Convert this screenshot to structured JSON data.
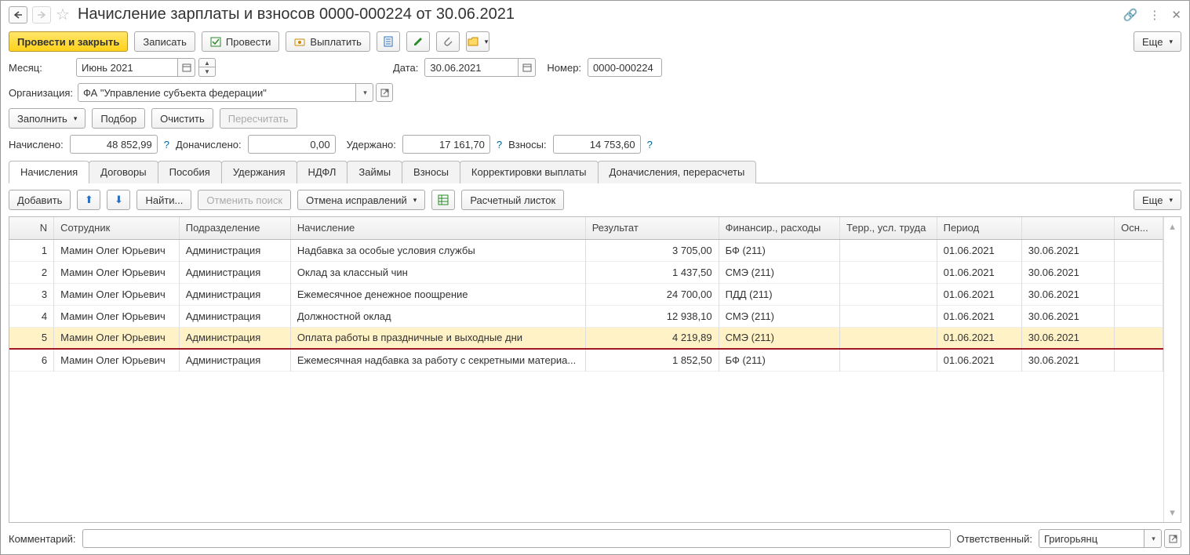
{
  "title": "Начисление зарплаты и взносов 0000-000224 от 30.06.2021",
  "toolbar": {
    "post_close": "Провести и закрыть",
    "save": "Записать",
    "post": "Провести",
    "pay": "Выплатить",
    "more": "Еще"
  },
  "fields": {
    "month_label": "Месяц:",
    "month_value": "Июнь 2021",
    "date_label": "Дата:",
    "date_value": "30.06.2021",
    "number_label": "Номер:",
    "number_value": "0000-000224",
    "org_label": "Организация:",
    "org_value": "ФА \"Управление субъекта федерации\""
  },
  "actions": {
    "fill": "Заполнить",
    "pick": "Подбор",
    "clear": "Очистить",
    "recalc": "Пересчитать"
  },
  "summary": {
    "accrued_label": "Начислено:",
    "accrued_value": "48 852,99",
    "added_label": "Доначислено:",
    "added_value": "0,00",
    "withheld_label": "Удержано:",
    "withheld_value": "17 161,70",
    "contrib_label": "Взносы:",
    "contrib_value": "14 753,60"
  },
  "tabs": [
    "Начисления",
    "Договоры",
    "Пособия",
    "Удержания",
    "НДФЛ",
    "Займы",
    "Взносы",
    "Корректировки выплаты",
    "Доначисления, перерасчеты"
  ],
  "gridbar": {
    "add": "Добавить",
    "find": "Найти...",
    "cancel_find": "Отменить поиск",
    "cancel_fix": "Отмена исправлений",
    "payslip": "Расчетный листок",
    "more": "Еще"
  },
  "columns": {
    "n": "N",
    "employee": "Сотрудник",
    "dept": "Подразделение",
    "accrual": "Начисление",
    "result": "Результат",
    "fin": "Финансир., расходы",
    "terr": "Терр., усл. труда",
    "period": "Период",
    "osn": "Осн..."
  },
  "rows": [
    {
      "n": "1",
      "emp": "Мамин Олег Юрьевич",
      "dept": "Администрация",
      "accr": "Надбавка за особые условия службы",
      "res": "3 705,00",
      "fin": "БФ (211)",
      "p1": "01.06.2021",
      "p2": "30.06.2021"
    },
    {
      "n": "2",
      "emp": "Мамин Олег Юрьевич",
      "dept": "Администрация",
      "accr": "Оклад за классный чин",
      "res": "1 437,50",
      "fin": "СМЭ (211)",
      "p1": "01.06.2021",
      "p2": "30.06.2021"
    },
    {
      "n": "3",
      "emp": "Мамин Олег Юрьевич",
      "dept": "Администрация",
      "accr": "Ежемесячное денежное поощрение",
      "res": "24 700,00",
      "fin": "ПДД (211)",
      "p1": "01.06.2021",
      "p2": "30.06.2021"
    },
    {
      "n": "4",
      "emp": "Мамин Олег Юрьевич",
      "dept": "Администрация",
      "accr": "Должностной оклад",
      "res": "12 938,10",
      "fin": "СМЭ (211)",
      "p1": "01.06.2021",
      "p2": "30.06.2021"
    },
    {
      "n": "5",
      "emp": "Мамин Олег Юрьевич",
      "dept": "Администрация",
      "accr": "Оплата работы в праздничные и выходные дни",
      "res": "4 219,89",
      "fin": "СМЭ (211)",
      "p1": "01.06.2021",
      "p2": "30.06.2021",
      "sel": true
    },
    {
      "n": "6",
      "emp": "Мамин Олег Юрьевич",
      "dept": "Администрация",
      "accr": "Ежемесячная надбавка за работу с секретными материа...",
      "res": "1 852,50",
      "fin": "БФ (211)",
      "p1": "01.06.2021",
      "p2": "30.06.2021"
    }
  ],
  "footer": {
    "comment_label": "Комментарий:",
    "responsible_label": "Ответственный:",
    "responsible_value": "Григорьянц"
  }
}
